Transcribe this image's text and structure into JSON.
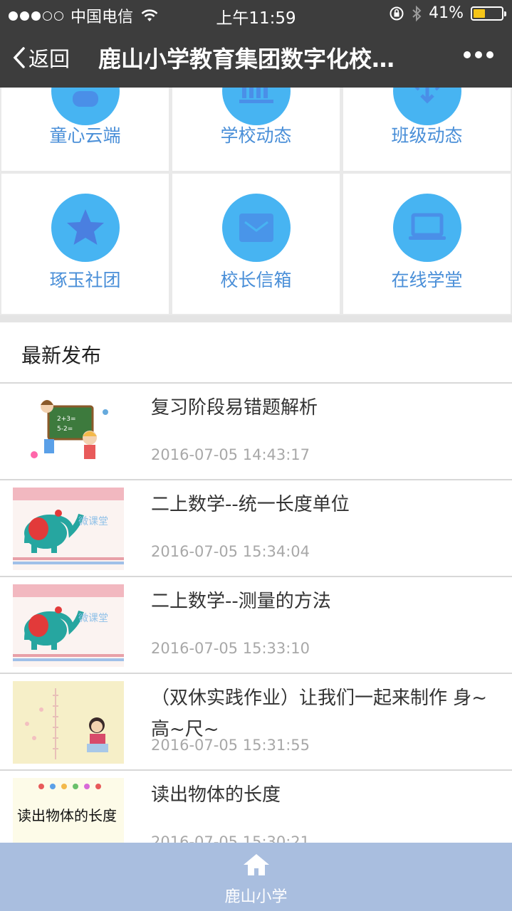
{
  "status_bar": {
    "carrier": "中国电信",
    "time": "上午11:59",
    "battery": "41%",
    "battery_level": 0.41
  },
  "nav": {
    "back_label": "返回",
    "title": "鹿山小学教育集团数字化校…"
  },
  "features": [
    {
      "label": "童心云端",
      "icon": "user-icon"
    },
    {
      "label": "学校动态",
      "icon": "building-icon"
    },
    {
      "label": "班级动态",
      "icon": "arrows-icon"
    },
    {
      "label": "琢玉社团",
      "icon": "star-icon"
    },
    {
      "label": "校长信箱",
      "icon": "mail-icon"
    },
    {
      "label": "在线学堂",
      "icon": "laptop-icon"
    }
  ],
  "latest": {
    "title": "最新发布",
    "items": [
      {
        "title": "复习阶段易错题解析",
        "time": "2016-07-05 14:43:17",
        "thumb": "kids-blackboard-image"
      },
      {
        "title": "二上数学--统一长度单位",
        "time": "2016-07-05 15:34:04",
        "thumb": "micro-class-elephant-image",
        "thumb_text": "微课堂"
      },
      {
        "title": "二上数学--测量的方法",
        "time": "2016-07-05 15:33:10",
        "thumb": "micro-class-elephant-image",
        "thumb_text": "微课堂"
      },
      {
        "title": "（双休实践作业）让我们一起来制作 身~高~尺~",
        "time": "2016-07-05 15:31:55",
        "thumb": "girl-height-chart-image"
      },
      {
        "title": "读出物体的长度",
        "time": "2016-07-05 15:30:21",
        "thumb": "handwritten-title-image",
        "thumb_text": "读出物体的长度"
      }
    ]
  },
  "tabbar": {
    "label": "鹿山小学",
    "icon": "home-icon"
  },
  "colors": {
    "nav_bg": "#3d3d3d",
    "icon_circle": "#47b4f2",
    "feature_label": "#4a8fd8",
    "tabbar_bg": "#a9bedf"
  }
}
